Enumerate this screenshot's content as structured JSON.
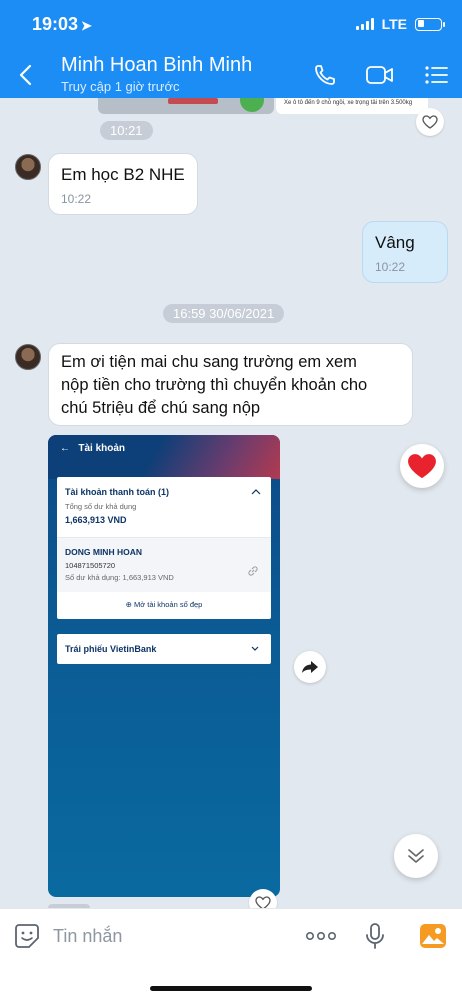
{
  "status_bar": {
    "time": "19:03",
    "network": "LTE"
  },
  "header": {
    "title": "Minh Hoan Binh Minh",
    "subtitle": "Truy cập 1 giờ trước"
  },
  "previous_message": {
    "caption": "Xe ô tô đến 9 chỗ ngồi, xe trọng tải trên 3.500kg",
    "time": "10:21"
  },
  "messages": [
    {
      "sender": "other",
      "text": "Em học  B2 NHE",
      "time": "10:22"
    },
    {
      "sender": "me",
      "text": "Vâng",
      "time": "10:22"
    }
  ],
  "date_separator": "16:59 30/06/2021",
  "long_message": {
    "lines": [
      "Em ơi tiện  mai chu sang trường  em xem",
      "nộp  tiền  cho trường  thì  chuyển khoản  cho",
      "chú  5triệu  để  chú  sang nộp"
    ]
  },
  "bank_screenshot": {
    "screen_title": "Tài khoản",
    "payment_account_header": "Tài khoản thanh toán (1)",
    "available_label": "Tổng số dư khả dụng",
    "available_value": "1,663,913 VND",
    "account_name": "DONG MINH HOAN",
    "account_number": "104871505720",
    "balance_line": "Số dư khả dụng: 1,663,913 VND",
    "open_account": "Mở tài khoản số đẹp",
    "bonds": "Trái phiếu VietinBank"
  },
  "input": {
    "placeholder": "Tin nhắn"
  },
  "colors": {
    "header_bg": "#1c8df5",
    "chat_bg": "#e2e8ef",
    "my_bubble": "#d6ecfb",
    "reaction": "#e8232d",
    "gallery": "#f59a23"
  }
}
